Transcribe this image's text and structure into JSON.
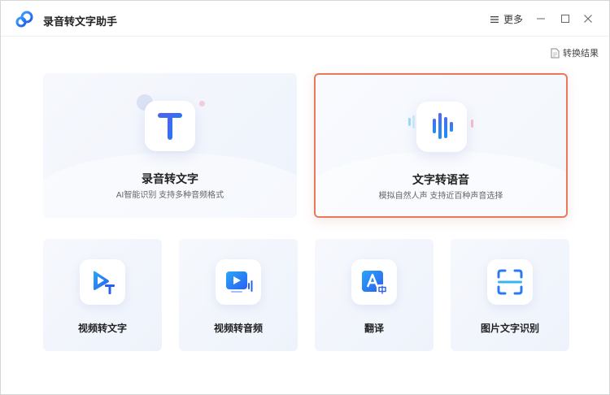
{
  "app": {
    "title": "录音转文字助手",
    "more_label": "更多",
    "result_label": "转换结果"
  },
  "colors": {
    "accent_blue": "#2a6ff3",
    "selected_border": "#e8795a"
  },
  "features": {
    "big": [
      {
        "title": "录音转文字",
        "subtitle": "AI智能识别 支持多种音频格式",
        "icon": "text-t-icon"
      },
      {
        "title": "文字转语音",
        "subtitle": "模拟自然人声 支持近百种声音选择",
        "icon": "sound-wave-icon",
        "selected": true
      }
    ],
    "small": [
      {
        "title": "视频转文字",
        "icon": "video-to-text-icon"
      },
      {
        "title": "视频转音频",
        "icon": "video-to-audio-icon"
      },
      {
        "title": "翻译",
        "icon": "translate-icon"
      },
      {
        "title": "图片文字识别",
        "icon": "image-ocr-icon"
      }
    ]
  }
}
